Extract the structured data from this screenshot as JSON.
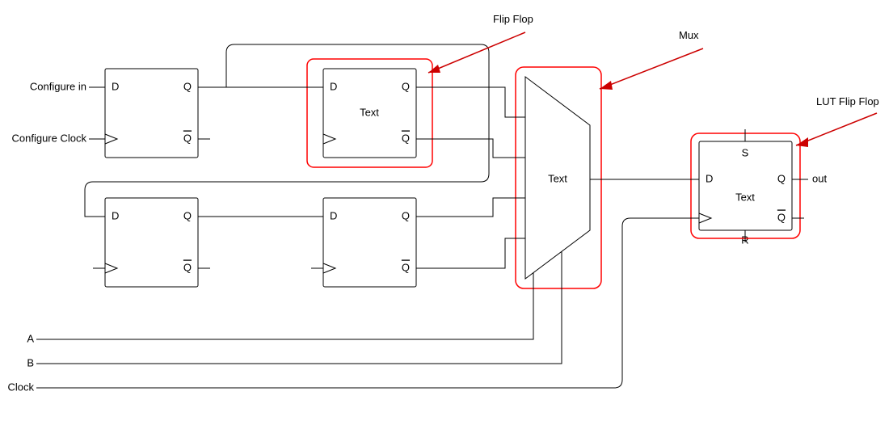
{
  "annotations": {
    "flipflop": "Flip Flop",
    "mux": "Mux",
    "lut_ff": "LUT Flip Flop"
  },
  "labels": {
    "cfg_in": "Configure in",
    "cfg_clk": "Configure Clock",
    "a": "A",
    "b": "B",
    "clk": "Clock",
    "out": "out"
  },
  "pins": {
    "D": "D",
    "Q": "Q",
    "Qbar": "Q",
    "S": "S",
    "R": "R"
  },
  "text": {
    "ff": "Text",
    "mux": "Text",
    "lut": "Text"
  },
  "colors": {
    "highlight": "#ff0000",
    "arrow": "#cc0000"
  }
}
